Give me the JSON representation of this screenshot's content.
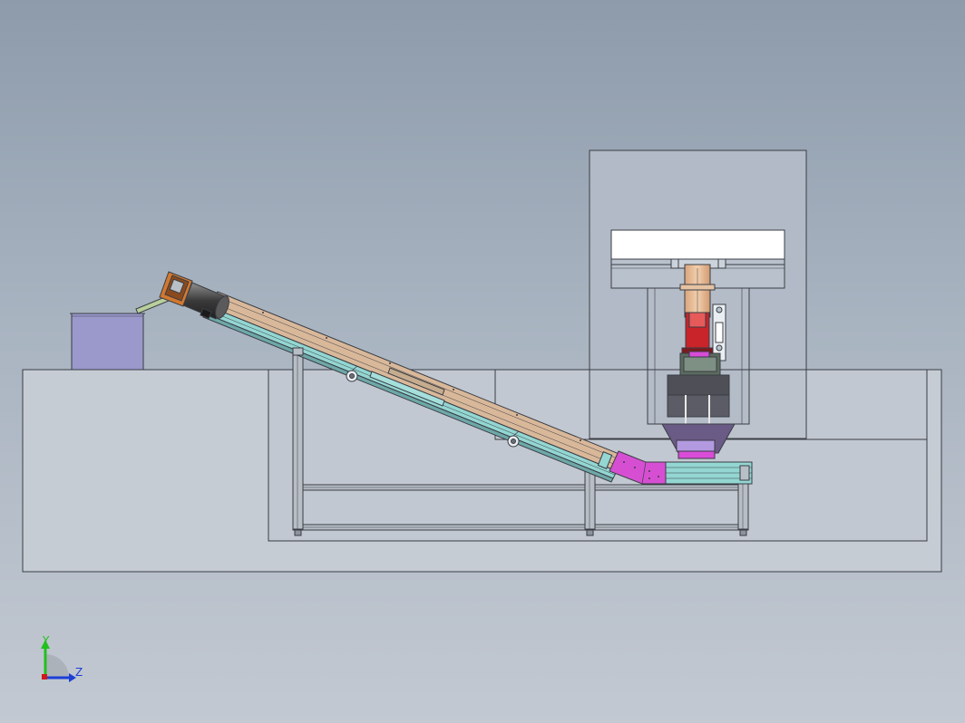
{
  "triad": {
    "y_label": "Y",
    "z_label": "Z",
    "colors": {
      "y_axis": "#22c01e",
      "z_axis": "#1d3fd6",
      "origin": "#d01818"
    }
  },
  "colors": {
    "background_top": "#8d9bab",
    "background_bottom": "#c3c9d2",
    "outline": "#3a3d44",
    "hopper": "#9b98cc",
    "belt_upper": "#d9b89a",
    "belt_lower": "#93d6d2",
    "transition_bracket": "#d64fd2",
    "motor_housing": "#d2782e",
    "press_panel": "#ffffff",
    "ram": "#e2b48e",
    "ram_tool": "#c8242a",
    "die_base": "#6a5a86",
    "die_lavender": "#b39ae0",
    "die_magenta": "#d84cd8"
  },
  "icons": {
    "triad": "axis-triad-icon",
    "roller": "roller-icon"
  }
}
